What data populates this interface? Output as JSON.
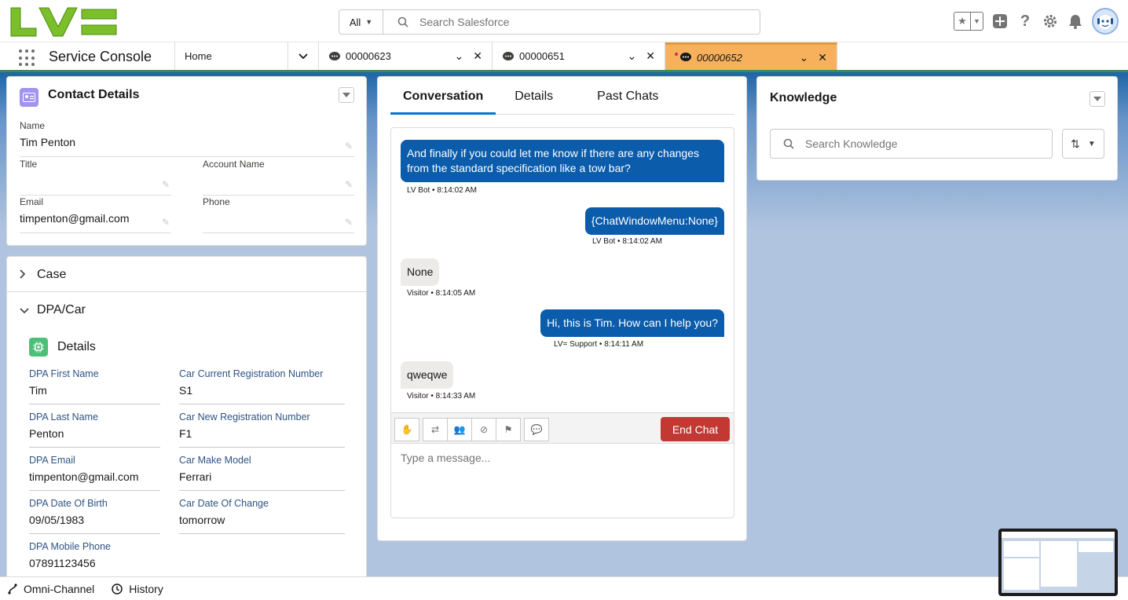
{
  "header": {
    "search_scope": "All",
    "search_placeholder": "Search Salesforce"
  },
  "nav": {
    "app_name": "Service Console",
    "home_tab": "Home",
    "tabs": [
      {
        "label": "00000623"
      },
      {
        "label": "00000651"
      },
      {
        "label": "00000652"
      }
    ]
  },
  "contact": {
    "title": "Contact Details",
    "name_label": "Name",
    "name_value": "Tim Penton",
    "title_label": "Title",
    "title_value": "",
    "account_label": "Account Name",
    "account_value": "",
    "email_label": "Email",
    "email_value": "timpenton@gmail.com",
    "phone_label": "Phone",
    "phone_value": ""
  },
  "sections": {
    "case_label": "Case",
    "dpa_label": "DPA/Car",
    "details_label": "Details"
  },
  "dpa": {
    "fields": [
      {
        "label": "DPA First Name",
        "value": "Tim"
      },
      {
        "label": "Car Current Registration Number",
        "value": "S1"
      },
      {
        "label": "DPA Last Name",
        "value": "Penton"
      },
      {
        "label": "Car New Registration Number",
        "value": "F1"
      },
      {
        "label": "DPA Email",
        "value": "timpenton@gmail.com"
      },
      {
        "label": "Car Make Model",
        "value": "Ferrari"
      },
      {
        "label": "DPA Date Of Birth",
        "value": "09/05/1983"
      },
      {
        "label": "Car Date Of Change",
        "value": "tomorrow"
      },
      {
        "label": "DPA Mobile Phone",
        "value": "07891123456"
      }
    ]
  },
  "conversation": {
    "tabs": [
      "Conversation",
      "Details",
      "Past Chats"
    ],
    "messages": [
      {
        "text": "And finally if you could let me know if there are any changes from the standard specification like a tow bar?",
        "meta": "LV Bot • 8:14:02 AM"
      },
      {
        "text": "{ChatWindowMenu:None}",
        "meta": "LV Bot • 8:14:02 AM"
      },
      {
        "text": "None",
        "meta": "Visitor • 8:14:05 AM"
      },
      {
        "text": "Hi, this is Tim. How can I help you?",
        "meta": "LV= Support • 8:14:11 AM"
      },
      {
        "text": "qweqwe",
        "meta": "Visitor • 8:14:33 AM"
      }
    ],
    "end_chat_label": "End Chat",
    "composer_placeholder": "Type a message..."
  },
  "knowledge": {
    "title": "Knowledge",
    "search_placeholder": "Search Knowledge"
  },
  "utility": {
    "omni_label": "Omni-Channel",
    "history_label": "History"
  },
  "colors": {
    "brand_blue": "#0b5cab",
    "active_tab": "#f7b15d",
    "end_chat": "#c23934",
    "logo_green": "#7bbf2a"
  }
}
